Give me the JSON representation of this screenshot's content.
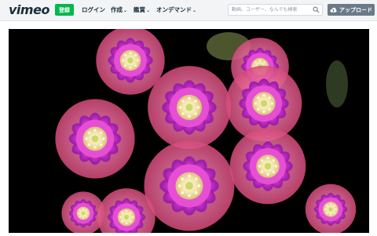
{
  "header": {
    "logo": "vimeo",
    "join_label": "登録",
    "nav": [
      {
        "label": "ログイン",
        "has_menu": false
      },
      {
        "label": "作成",
        "has_menu": true
      },
      {
        "label": "鑑賞",
        "has_menu": true
      },
      {
        "label": "オンデマンド",
        "has_menu": true
      }
    ],
    "search_placeholder": "動画、ユーザー、なんでも検索",
    "upload_label": "アップロード"
  },
  "colors": {
    "header_bg": "#f2f4f5",
    "join_green": "#00b84c",
    "upload_gray": "#6a7a88",
    "text_dark": "#1a2e3b"
  },
  "video": {
    "description_icon": "cactus-flowers-video-frame"
  }
}
